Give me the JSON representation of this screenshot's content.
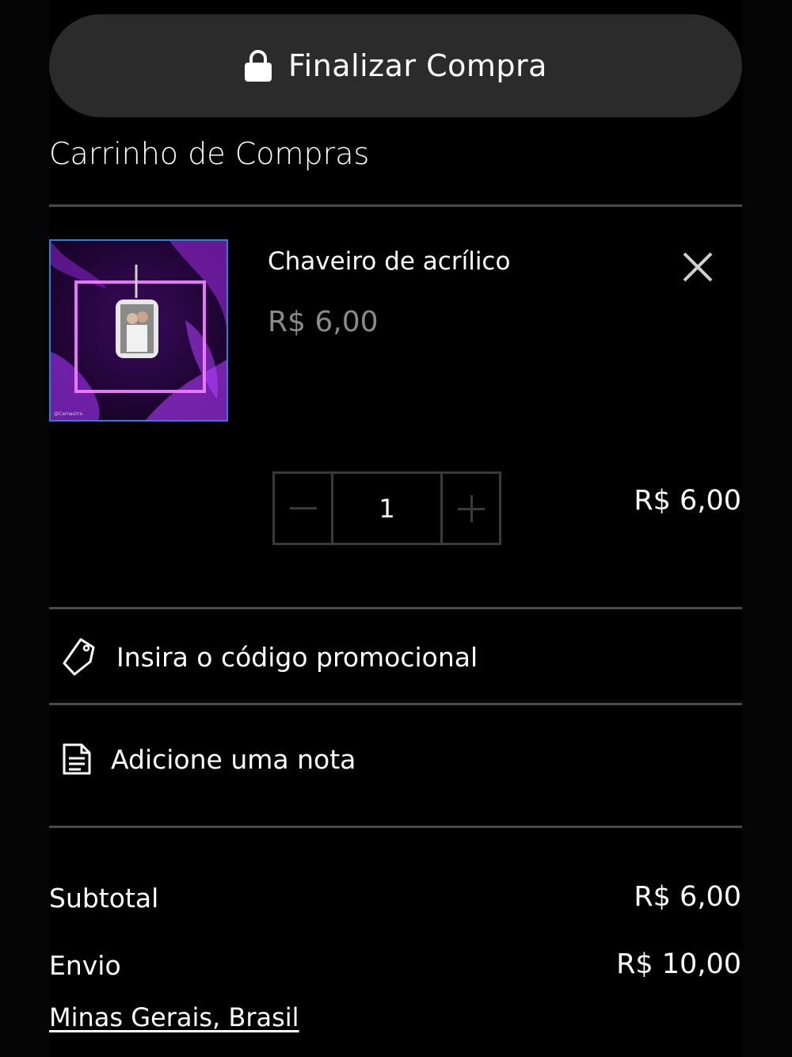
{
  "checkout": {
    "label": "Finalizar Compra",
    "icon": "lock-icon"
  },
  "cart": {
    "title": "Carrinho de Compras",
    "item": {
      "name": "Chaveiro de acrílico",
      "price": "R$ 6,00",
      "quantity": "1",
      "line_total": "R$ 6,00",
      "thumbnail_watermark": "@Carnaúrra"
    }
  },
  "promo": {
    "label": "Insira o código promocional",
    "icon": "tag-icon"
  },
  "note": {
    "label": "Adicione uma nota",
    "icon": "note-icon"
  },
  "summary": {
    "subtotal_label": "Subtotal",
    "subtotal_value": "R$ 6,00",
    "shipping_label": "Envio",
    "shipping_value": "R$ 10,00",
    "location": "Minas Gerais, Brasil"
  },
  "colors": {
    "background": "#000000",
    "button": "#2b2b2b",
    "divider": "#4a4a4a",
    "muted_price": "#8a8a8a",
    "thumb_border": "#2b7fd8",
    "thumb_accent": "#a020f0"
  }
}
